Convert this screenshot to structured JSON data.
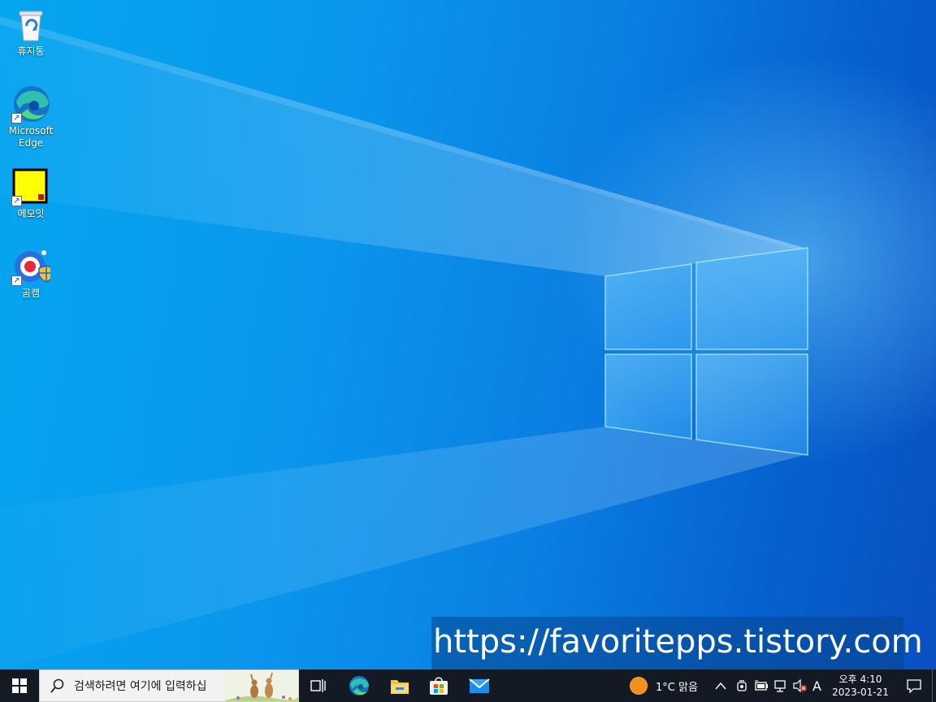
{
  "desktop": {
    "icons": [
      {
        "label": "휴지통"
      },
      {
        "label": "Microsoft Edge"
      },
      {
        "label": "메모잇"
      },
      {
        "label": "곰캠"
      }
    ],
    "watermark_text": "https://favoritepps.tistory.com"
  },
  "taskbar": {
    "search_placeholder": "검색하려면 여기에 입력하십",
    "pinned": [
      {
        "icon": "task-view-icon"
      },
      {
        "icon": "edge-icon"
      },
      {
        "icon": "file-explorer-icon"
      },
      {
        "icon": "store-icon"
      },
      {
        "icon": "mail-icon"
      }
    ],
    "weather": {
      "text": "1°C  맑음",
      "icon": "sun-icon"
    },
    "ime_indicator": "A",
    "clock": {
      "time": "오후 4:10",
      "date": "2023-01-21"
    }
  },
  "colors": {
    "taskbar_bg": "#141a24",
    "desktop_accent": "#0a78e0",
    "memo_yellow": "#ffff00"
  }
}
